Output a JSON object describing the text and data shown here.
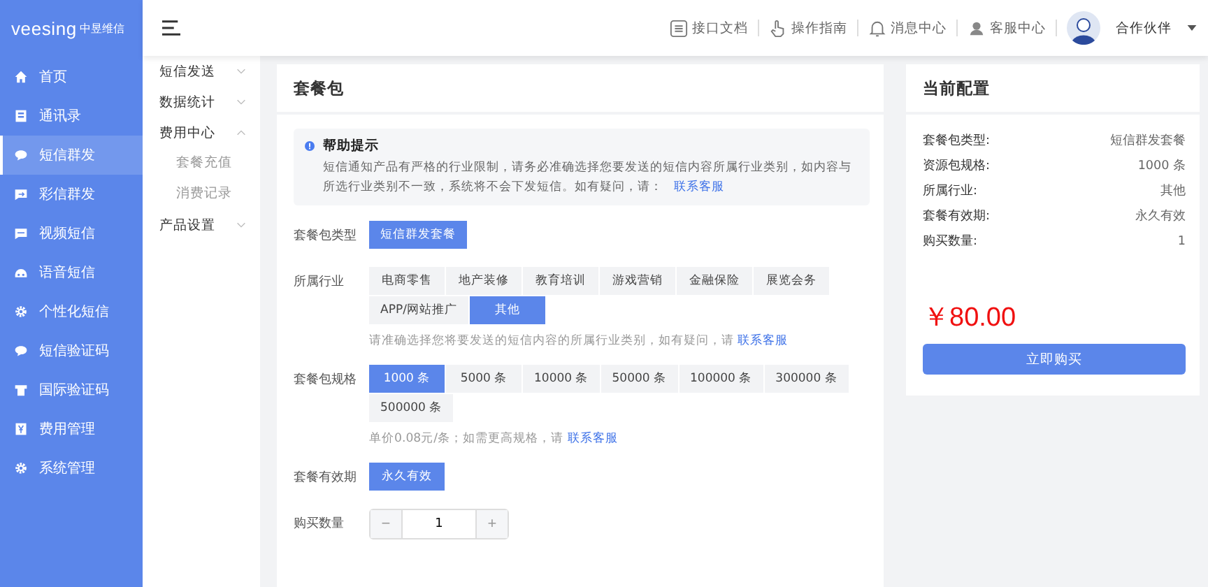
{
  "logo": {
    "text": "veesing",
    "subtext": "中昱维信"
  },
  "sidebar": {
    "items": [
      {
        "label": "首页",
        "selected": false
      },
      {
        "label": "通讯录",
        "selected": false
      },
      {
        "label": "短信群发",
        "selected": true
      },
      {
        "label": "彩信群发",
        "selected": false
      },
      {
        "label": "视频短信",
        "selected": false
      },
      {
        "label": "语音短信",
        "selected": false
      },
      {
        "label": "个性化短信",
        "selected": false
      },
      {
        "label": "短信验证码",
        "selected": false
      },
      {
        "label": "国际验证码",
        "selected": false
      },
      {
        "label": "费用管理",
        "selected": false
      },
      {
        "label": "系统管理",
        "selected": false
      }
    ]
  },
  "submenu": [
    {
      "label": "短信发送",
      "expanded": false
    },
    {
      "label": "数据统计",
      "expanded": false
    },
    {
      "label": "费用中心",
      "expanded": true,
      "children": [
        {
          "label": "套餐充值"
        },
        {
          "label": "消费记录"
        }
      ]
    },
    {
      "label": "产品设置",
      "expanded": false
    }
  ],
  "header": {
    "links": [
      {
        "label": "接口文档"
      },
      {
        "label": "操作指南"
      },
      {
        "label": "消息中心"
      },
      {
        "label": "客服中心"
      }
    ],
    "user": "合作伙伴"
  },
  "main": {
    "title": "套餐包",
    "help": {
      "title": "帮助提示",
      "text": "短信通知产品有严格的行业限制，请务必准确选择您要发送的短信内容所属行业类别，如内容与所选行业类别不一致，系统将不会下发短信。如有疑问，请：",
      "link": "联系客服"
    },
    "fields": [
      {
        "label": "套餐包类型",
        "options": [
          {
            "label": "短信群发套餐",
            "selected": true
          }
        ]
      },
      {
        "label": "所属行业",
        "options": [
          {
            "label": "电商零售",
            "selected": false
          },
          {
            "label": "地产装修",
            "selected": false
          },
          {
            "label": "教育培训",
            "selected": false
          },
          {
            "label": "游戏营销",
            "selected": false
          },
          {
            "label": "金融保险",
            "selected": false
          },
          {
            "label": "展览会务",
            "selected": false
          },
          {
            "label": "APP/网站推广",
            "selected": false
          },
          {
            "label": "其他",
            "selected": true
          }
        ],
        "hint": "请准确选择您将要发送的短信内容的所属行业类别，如有疑问，请",
        "hint_link": "联系客服"
      },
      {
        "label": "套餐包规格",
        "options": [
          {
            "label": "1000 条",
            "selected": true
          },
          {
            "label": "5000 条",
            "selected": false
          },
          {
            "label": "10000 条",
            "selected": false
          },
          {
            "label": "50000 条",
            "selected": false
          },
          {
            "label": "100000 条",
            "selected": false
          },
          {
            "label": "300000 条",
            "selected": false
          },
          {
            "label": "500000 条",
            "selected": false
          }
        ],
        "hint": "单价0.08元/条；如需更高规格，请",
        "hint_link": "联系客服"
      },
      {
        "label": "套餐有效期",
        "options": [
          {
            "label": "永久有效",
            "selected": true
          }
        ]
      }
    ],
    "quantity": {
      "label": "购买数量",
      "value": "1",
      "minus": "−",
      "plus": "+"
    }
  },
  "summary": {
    "title": "当前配置",
    "rows": [
      {
        "label": "套餐包类型:",
        "value": "短信群发套餐"
      },
      {
        "label": "资源包规格:",
        "value": "1000 条"
      },
      {
        "label": "所属行业:",
        "value": "其他"
      },
      {
        "label": "套餐有效期:",
        "value": "永久有效"
      },
      {
        "label": "购买数量:",
        "value": "1"
      }
    ],
    "price": "￥80.00",
    "button": "立即购买"
  }
}
